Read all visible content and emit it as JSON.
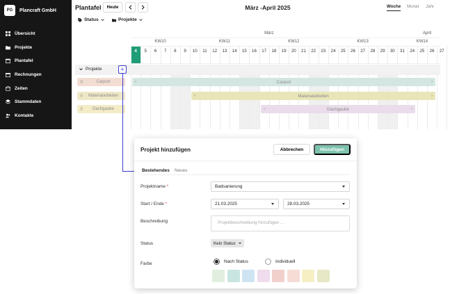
{
  "brand": {
    "initials": "PG",
    "name": "Plancraft GmbH"
  },
  "sidebar": {
    "items": [
      {
        "label": "Übersicht",
        "icon": "dashboard-icon"
      },
      {
        "label": "Projekte",
        "icon": "folder-icon"
      },
      {
        "label": "Plantafel",
        "icon": "calendar-icon"
      },
      {
        "label": "Rechnungen",
        "icon": "invoice-icon"
      },
      {
        "label": "Zeiten",
        "icon": "time-icon"
      },
      {
        "label": "Stammdaten",
        "icon": "layers-icon"
      },
      {
        "label": "Kontakte",
        "icon": "contacts-icon"
      }
    ]
  },
  "header": {
    "title": "Plantafel",
    "today_label": "Heute",
    "range_title": "März -April 2025",
    "views": {
      "week": "Woche",
      "month": "Monat",
      "year": "Jahr"
    },
    "filters": {
      "status": "Status",
      "projects": "Projekte"
    }
  },
  "calendar": {
    "months": [
      {
        "label": "März"
      },
      {
        "label": "April"
      }
    ],
    "weeks": [
      "KW10",
      "KW11",
      "KW12",
      "KW13",
      "KW14"
    ],
    "days": [
      4,
      5,
      6,
      7,
      8,
      9,
      10,
      11,
      12,
      13,
      14,
      15,
      16,
      17,
      18,
      19,
      20,
      21,
      22,
      23,
      24,
      25,
      26,
      27,
      28,
      29,
      30,
      31,
      24,
      25,
      26,
      27
    ],
    "today_day": 4,
    "group_label": "Projekte",
    "projects": [
      {
        "name": "Carport",
        "chip_color": "#f2ddd3",
        "bar_color": "#d4e6e1"
      },
      {
        "name": "Materialarbeiten",
        "chip_color": "#efe8c7",
        "bar_color": "#e8e5b8"
      },
      {
        "name": "Dachgaube",
        "chip_color": "#f3ecc7",
        "bar_color": "#eadcea"
      }
    ]
  },
  "modal": {
    "title": "Projekt hinzufügen",
    "cancel_label": "Abbrechen",
    "submit_label": "Hinzufügen",
    "tabs": {
      "existing": "Bestehendes",
      "new": "Neues"
    },
    "project_name_label": "Projektname",
    "project_name_value": "Badsanierung",
    "start_end_label": "Start / Ende",
    "start_value": "21.03.2025",
    "end_value": "28.03.2025",
    "description_label": "Beschreibung",
    "description_placeholder": "Projektbeschreibung hinzufügen ...",
    "status_label": "Status",
    "status_value": "Kein Status",
    "color_label": "Farbe",
    "color_options": {
      "by_status": "Nach Status",
      "individual": "Individuell"
    },
    "swatches": [
      "#e2efe0",
      "#c9e5e1",
      "#cfe4f2",
      "#efdcec",
      "#f1d0cc",
      "#f6dcd5",
      "#f5efc3",
      "#e6e8c6"
    ],
    "required_mark": "*"
  }
}
